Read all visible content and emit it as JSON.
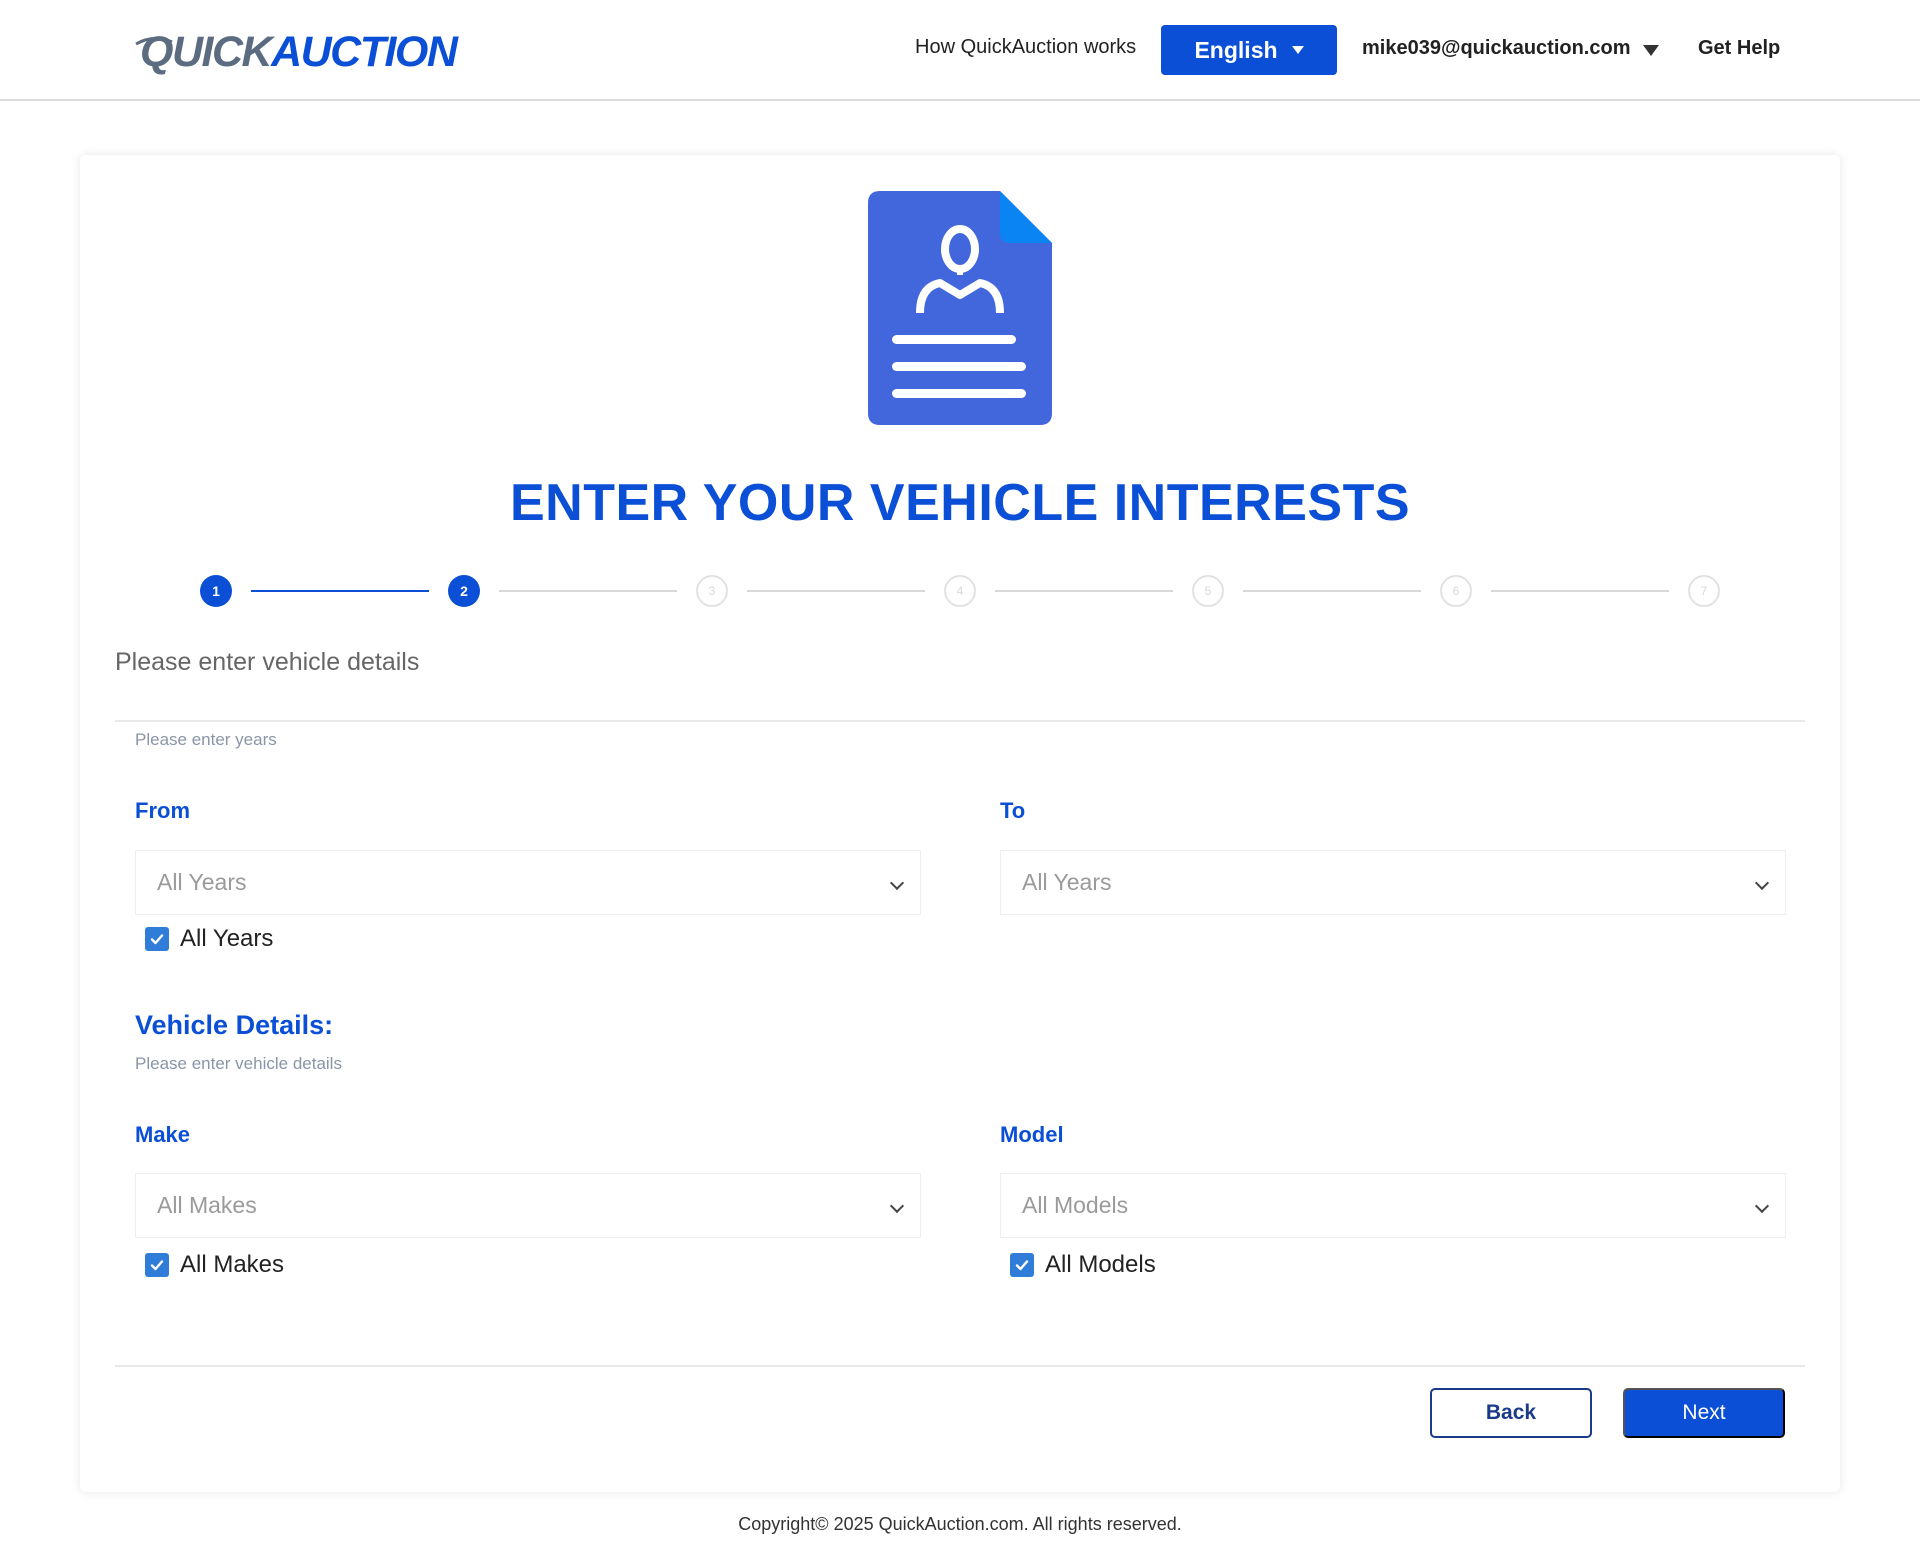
{
  "header": {
    "logo": {
      "part1": "QUICK",
      "part2": "AUCTION"
    },
    "nav_how": "How QuickAuction works",
    "language": "English",
    "user_email": "mike039@quickauction.com",
    "help": "Get Help"
  },
  "main": {
    "title": "ENTER YOUR VEHICLE INTERESTS",
    "steps": [
      {
        "label": "1",
        "state": "active"
      },
      {
        "label": "2",
        "state": "active"
      },
      {
        "label": "3",
        "state": "inactive"
      },
      {
        "label": "4",
        "state": "inactive"
      },
      {
        "label": "5",
        "state": "inactive"
      },
      {
        "label": "6",
        "state": "inactive"
      },
      {
        "label": "7",
        "state": "inactive"
      }
    ],
    "intro": "Please enter vehicle details",
    "years": {
      "hint": "Please enter years",
      "from_label": "From",
      "from_value": "All Years",
      "to_label": "To",
      "to_value": "All Years",
      "all_years_checkbox": "All Years",
      "all_years_checked": true
    },
    "vehicle": {
      "heading": "Vehicle Details:",
      "hint": "Please enter vehicle details",
      "make_label": "Make",
      "make_value": "All Makes",
      "model_label": "Model",
      "model_value": "All Models",
      "all_makes_checkbox": "All Makes",
      "all_makes_checked": true,
      "all_models_checkbox": "All Models",
      "all_models_checked": true
    },
    "buttons": {
      "back": "Back",
      "next": "Next"
    }
  },
  "footer": {
    "copyright": "Copyright© 2025 QuickAuction.com. All rights reserved."
  },
  "colors": {
    "brand_blue": "#0a4fd6",
    "checkbox_blue": "#2f7cd9",
    "doc_icon_blue": "#4266dc",
    "doc_fold_blue": "#0a84f2"
  },
  "icons": {
    "doc": "document-user-icon",
    "check": "checkmark-icon",
    "chevron": "chevron-down-icon",
    "caret": "caret-down-icon"
  }
}
